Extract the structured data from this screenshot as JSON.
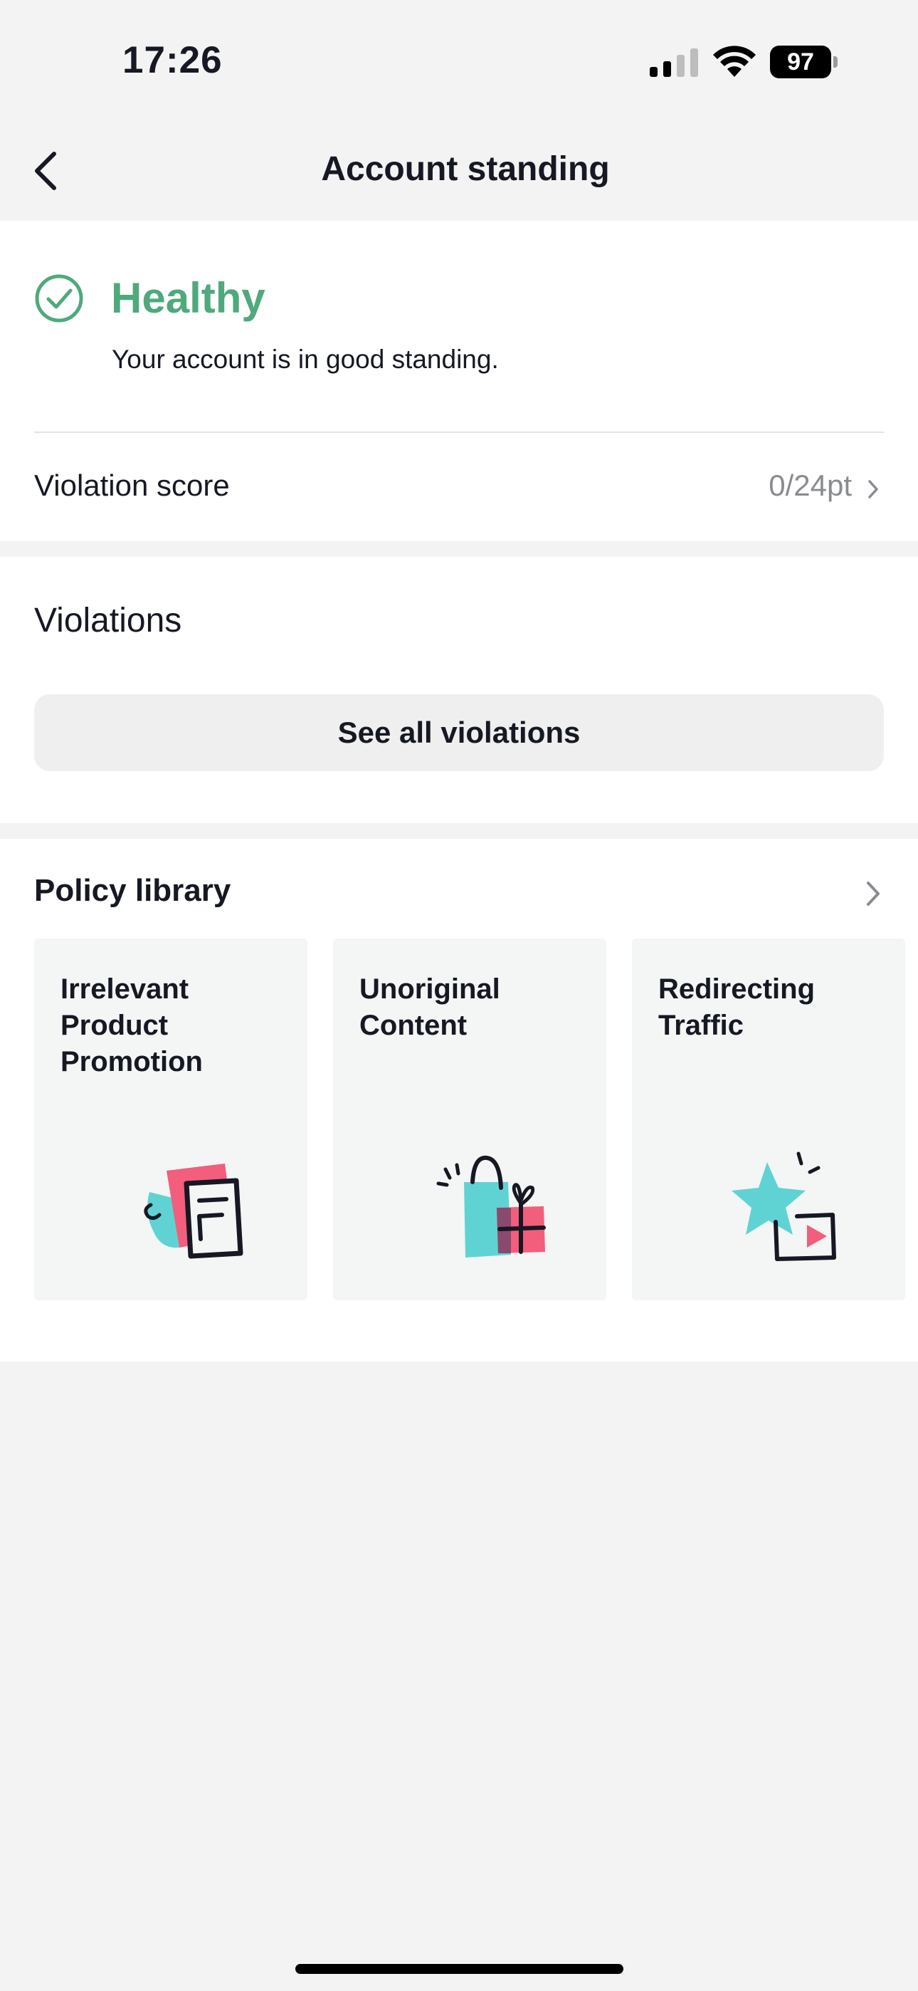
{
  "status_bar": {
    "time": "17:26",
    "battery": "97"
  },
  "nav": {
    "title": "Account standing"
  },
  "status": {
    "title": "Healthy",
    "description": "Your account is in good standing.",
    "color": "#4fa97c"
  },
  "score": {
    "label": "Violation score",
    "value": "0/24pt"
  },
  "violations": {
    "title": "Violations",
    "see_all_label": "See all violations"
  },
  "policy": {
    "title": "Policy library",
    "cards": [
      {
        "title": "Irrelevant\nProduct\nPromotion",
        "icon": "document-icon"
      },
      {
        "title": "Unoriginal\nContent",
        "icon": "shopping-gift-icon"
      },
      {
        "title": "Redirecting\nTraffic",
        "icon": "star-video-icon"
      }
    ]
  },
  "colors": {
    "accent_teal": "#5fd3d4",
    "accent_pink": "#f25e7b"
  }
}
